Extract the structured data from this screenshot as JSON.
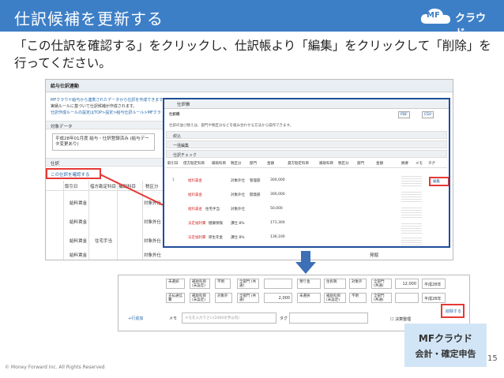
{
  "header": {
    "title": "仕訳候補を更新する",
    "logo_mf": "MF",
    "logo_text": "クラウド"
  },
  "instruction": "「この仕訳を確認する」をクリックし、仕訳帳より「編集」をクリックして「削除」を行ってください。",
  "shot1": {
    "header": "給与仕訳連動",
    "desc_lines": [
      "MFクラウド給与から連携されたデータから仕訳を作成できます。",
      "実績ルールに基づいて仕訳候補が作成されます。",
      "仕訳作成ルールの設定はTOP>設定>給与仕訳ルール>MFクラ"
    ],
    "section_target": "対象データ",
    "select_value": "平成28年01月度 給与・仕訳登録済み (給与データ変更あり)",
    "section_journal": "仕訳",
    "confirm_link": "この仕訳を確認する",
    "grid_headers": [
      "取引日",
      "借方勘定科目",
      "補助科目",
      "税区分"
    ],
    "grid_rows": [
      [
        "",
        "給料賃金",
        "",
        "対象外仕"
      ],
      [
        "",
        "給料賃金",
        "",
        "対象外仕"
      ],
      [
        "",
        "給料賃金",
        "住宅手当",
        "対象外仕"
      ],
      [
        "",
        "給料賃金",
        "",
        "対象外仕"
      ]
    ],
    "footer_label": "発掘"
  },
  "popup": {
    "header": "仕訳帳",
    "subheader": "仕訳帳",
    "note": "仕訳の並び替えは、部門や税区分などを組み合わせる方法から操作できます。",
    "btn_pdf": "PDF",
    "btn_csv": "CSV",
    "sec_filter": "絞込",
    "sec_summary": "一括編集",
    "sec_check": "仕訳チェック",
    "col_headers": [
      "取引日",
      "借方勘定科目",
      "補助科目",
      "税区分",
      "部門",
      "金額",
      "貸方勘定科目",
      "補助科目",
      "税区分",
      "部門",
      "金額",
      "摘要",
      "メモ",
      "タグ"
    ],
    "rows": [
      {
        "debit": "給料賃金",
        "tax": "対象外仕",
        "dept": "管理部",
        "amount": "300,000",
        "credit": "",
        "credit_tax": ""
      },
      {
        "debit": "給料賃金",
        "tax": "対象外仕",
        "dept": "開発部",
        "amount": "300,000",
        "credit": "",
        "credit_tax": ""
      },
      {
        "debit": "給料賃金",
        "tax": "対象外仕",
        "dept": "",
        "amount": "50,000",
        "credit": "住宅手当",
        "credit_tax": ""
      },
      {
        "debit": "法定福利費",
        "tax": "課税仕入",
        "dept": "",
        "amount": "171,300",
        "credit": "健康保険",
        "credit_tax": "課仕 8%"
      },
      {
        "debit": "法定福利費",
        "tax": "課税仕入",
        "dept": "",
        "amount": "136,100",
        "credit": "厚生年金",
        "credit_tax": "課仕 8%"
      }
    ],
    "edit_label": "編集",
    "date_label": "1"
  },
  "shot2": {
    "row1": {
      "debit_tax": "未選択",
      "sub1": "補助科目\n(未設定)",
      "tax1": "不明",
      "dept1": "全部門\n(共通)",
      "credit": "預り金",
      "tax2": "住民税",
      "tax3": "対象外",
      "dept2": "全部門\n(共通)",
      "amount": "12,000",
      "date": "平成28年"
    },
    "row2": {
      "debit": "支払通信費",
      "sub1": "補助科目\n(未設定)",
      "tax1": "対象外",
      "dept1": "全部門\n(共通)",
      "amount1": "2,000",
      "credit": "未選択",
      "sub2": "補助科目\n(未設定)",
      "tax2": "不明",
      "dept2": "全部門\n(共通)",
      "date": "平成28年"
    },
    "add_row": "+行追加",
    "memo_label": "メモ",
    "memo_placeholder": "メモを入力下さい(2000文字以内)",
    "tag_label": "タグ",
    "settled_label": "決算整理",
    "delete_label": "削除する"
  },
  "footer": {
    "copyright": "© Money Forward Inc. All Rights Reserved",
    "badge_line1": "MFクラウド",
    "badge_line2": "会計・確定申告",
    "page": "15"
  },
  "colors": {
    "header_bg": "#3d7fc7",
    "highlight": "#e53935",
    "link": "#2266aa",
    "badge_bg": "#d2e5f6"
  }
}
